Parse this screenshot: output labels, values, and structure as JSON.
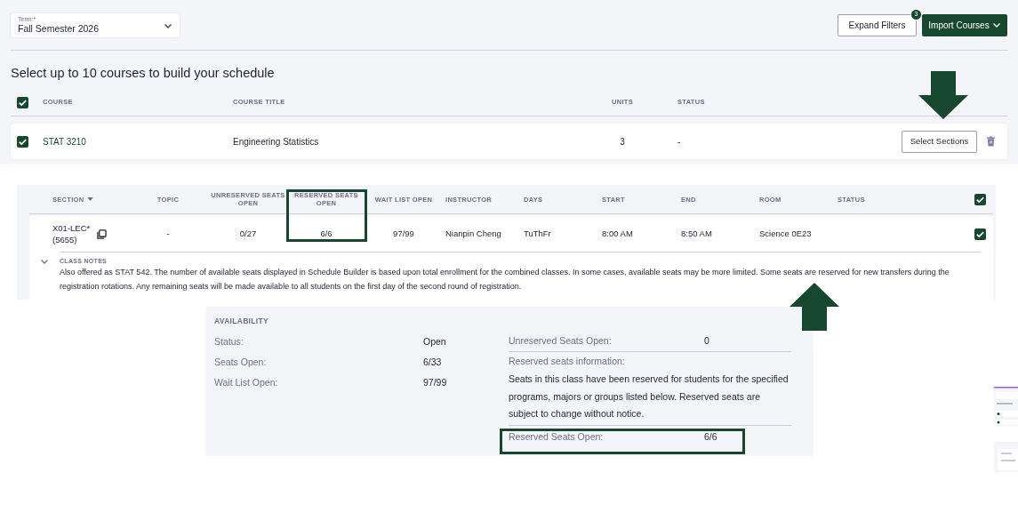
{
  "term": {
    "label": "Term:",
    "required_mark": "*",
    "value": "Fall Semester 2026"
  },
  "toolbar": {
    "expand_filters": "Expand Filters",
    "filter_count": "3",
    "import_courses": "Import Courses"
  },
  "heading": "Select up to 10 courses to build your schedule",
  "course_table": {
    "all_checked": true,
    "columns": [
      "COURSE",
      "COURSE TITLE",
      "UNITS",
      "STATUS"
    ],
    "rows": [
      {
        "checked": true,
        "course": "STAT 3210",
        "title": "Engineering Statistics",
        "units": "3",
        "status": "-",
        "action": "Select Sections"
      }
    ]
  },
  "section_table": {
    "all_checked": true,
    "columns": [
      {
        "label": "SECTION",
        "sortable": true
      },
      {
        "label": "TOPIC"
      },
      {
        "label": "UNRESERVED SEATS OPEN"
      },
      {
        "label": "RESERVED SEATS OPEN",
        "highlighted": true
      },
      {
        "label": "WAIT LIST OPEN"
      },
      {
        "label": "INSTRUCTOR"
      },
      {
        "label": "DAYS"
      },
      {
        "label": "START"
      },
      {
        "label": "END"
      },
      {
        "label": "ROOM"
      },
      {
        "label": "STATUS"
      }
    ],
    "rows": [
      {
        "section": "X01-LEC*",
        "class_number": "(5655)",
        "topic": "-",
        "unreserved": "0/27",
        "reserved": "6/6",
        "wait_list": "97/99",
        "instructor": "Nianpin Cheng",
        "days": "TuThFr",
        "start": "8:00 AM",
        "end": "8:50 AM",
        "room": "Science 0E23",
        "checked": true,
        "expanded": true,
        "notes_label": "CLASS NOTES",
        "notes": "Also offered as STAT 542. The number of available seats displayed in Schedule Builder is based upon total enrollment for the combined classes. In some cases, available seats may be more limited. Some seats are reserved for new transfers during the registration rotations. Any remaining seats will be made available to all students on the first day of the second round of registration."
      }
    ]
  },
  "availability": {
    "title": "AVAILABILITY",
    "left": [
      {
        "label": "Status:",
        "value": "Open"
      },
      {
        "label": "Seats Open:",
        "value": "6/33"
      },
      {
        "label": "Wait List Open:",
        "value": "97/99"
      }
    ],
    "unreserved": {
      "label": "Unreserved Seats Open:",
      "value": "0"
    },
    "reserved_info": {
      "label": "Reserved seats information:",
      "text": "Seats in this class have been reserved for students for the specified programs, majors or groups listed below. Reserved seats are subject to change without notice."
    },
    "reserved_open": {
      "label": "Reserved Seats Open:",
      "value": "6/6",
      "highlighted": true
    }
  }
}
